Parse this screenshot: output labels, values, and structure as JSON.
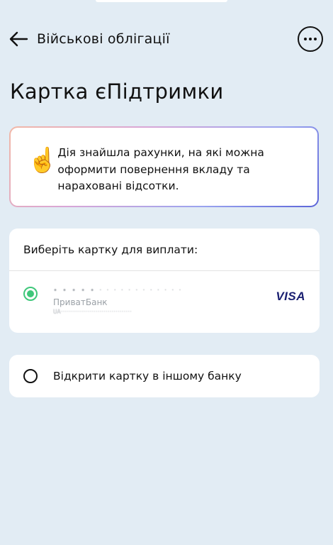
{
  "header": {
    "title": "Військові облігації",
    "back_icon": "arrow-left-icon",
    "more_icon": "more-horizontal-icon"
  },
  "page": {
    "title": "Картка єПідтримки"
  },
  "notice": {
    "emoji": "☝️",
    "text": "Дія знайшла рахунки, на які можна оформити повернення вкладу та нараховані відсотки."
  },
  "card_selection": {
    "title": "Виберіть картку для виплати:",
    "cards": [
      {
        "masked_number": "• • • • •  ‧ ‧ ‧ ‧ ‧ ‧ ‧ ‧   ‧ ‧ ‧ ‧",
        "bank_name": "ПриватБанк",
        "masked_iban": "UA‧‧‧‧‧‧‧‧‧‧‧‧‧‧‧‧‧‧‧‧‧‧‧‧‧‧‧‧‧‧‧‧‧‧‧",
        "network": "VISA",
        "selected": true
      }
    ]
  },
  "open_other_bank": {
    "label": "Відкрити картку в іншому банку",
    "selected": false
  },
  "colors": {
    "background": "#e2ecf4",
    "radio_selected": "#3fc77a",
    "visa": "#1a1f71"
  }
}
